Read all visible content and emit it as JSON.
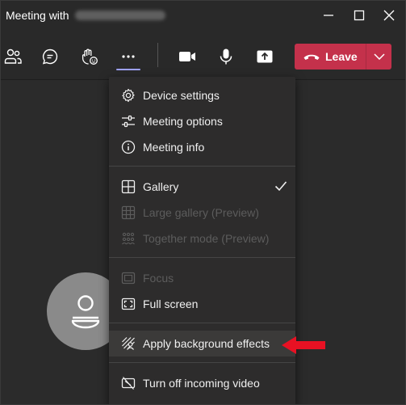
{
  "window": {
    "title": "Meeting with",
    "title_obscured": true
  },
  "toolbar": {
    "leave_label": "Leave",
    "icons": [
      "people-icon",
      "chat-icon",
      "raise-hand-icon",
      "more-options-icon",
      "camera-icon",
      "microphone-icon",
      "share-screen-icon"
    ],
    "active": "more-options-icon"
  },
  "menu": {
    "device_settings": "Device settings",
    "meeting_options": "Meeting options",
    "meeting_info": "Meeting info",
    "gallery": "Gallery",
    "large_gallery": "Large gallery (Preview)",
    "together_mode": "Together mode (Preview)",
    "focus": "Focus",
    "full_screen": "Full screen",
    "apply_background": "Apply background effects",
    "turn_off_video": "Turn off incoming video"
  },
  "colors": {
    "leave_button": "#c4314b",
    "accent": "#9ea2ff",
    "annotation_arrow": "#e81123"
  }
}
